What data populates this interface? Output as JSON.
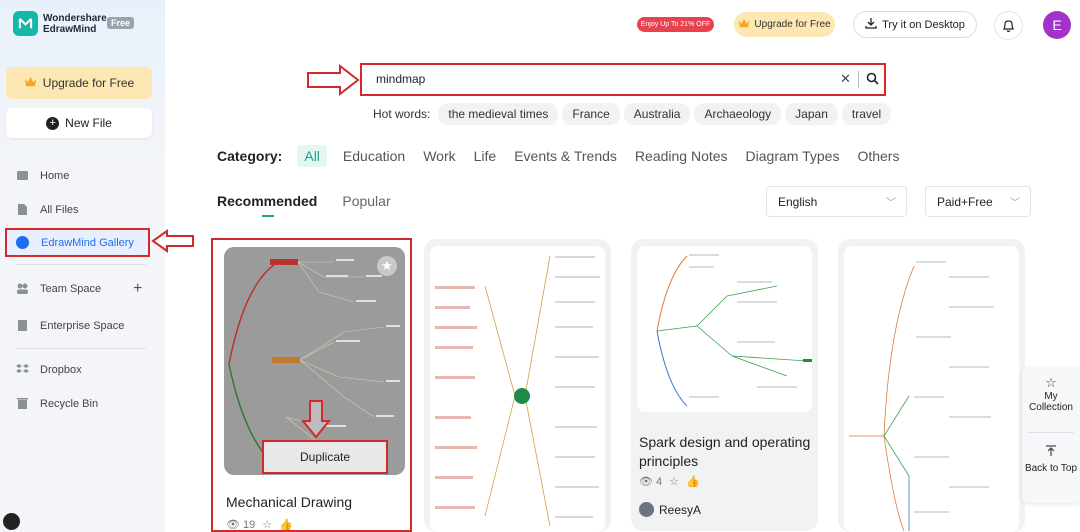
{
  "app": {
    "brand_line1": "Wondershare",
    "brand_line2": "EdrawMind",
    "plan_badge": "Free"
  },
  "sidebar": {
    "upgrade_label": "Upgrade for Free",
    "new_file_label": "New File",
    "items": [
      {
        "label": "Home",
        "icon": "home-icon"
      },
      {
        "label": "All Files",
        "icon": "files-icon"
      },
      {
        "label": "EdrawMind Gallery",
        "icon": "gallery-icon"
      },
      {
        "label": "Team Space",
        "icon": "team-icon"
      },
      {
        "label": "Enterprise Space",
        "icon": "enterprise-icon"
      },
      {
        "label": "Dropbox",
        "icon": "dropbox-icon"
      },
      {
        "label": "Recycle Bin",
        "icon": "trash-icon"
      }
    ]
  },
  "topbar": {
    "promo": "Enjoy Up To 21% OFF",
    "upgrade_label": "Upgrade for Free",
    "desktop_label": "Try it on Desktop",
    "avatar_initial": "E"
  },
  "search": {
    "value": "mindmap",
    "hot_label": "Hot words:",
    "hot_words": [
      "the medieval times",
      "France",
      "Australia",
      "Archaeology",
      "Japan",
      "travel"
    ]
  },
  "category": {
    "label": "Category:",
    "items": [
      "All",
      "Education",
      "Work",
      "Life",
      "Events & Trends",
      "Reading Notes",
      "Diagram Types",
      "Others"
    ]
  },
  "tabs": {
    "recommended": "Recommended",
    "popular": "Popular"
  },
  "filters": {
    "language": "English",
    "price": "Paid+Free"
  },
  "cards": [
    {
      "title": "Mechanical Drawing",
      "views": "19",
      "action": "Duplicate"
    },
    {
      "title": ""
    },
    {
      "title": "Spark design and operating principles",
      "views": "4",
      "author": "ReesyA"
    },
    {
      "title": ""
    }
  ],
  "floating": {
    "collection": "My Collection",
    "back_to_top": "Back to Top"
  },
  "colors": {
    "accent": "#1aa58b",
    "highlight": "#d22a2a",
    "active_nav": "#1e6ef0",
    "avatar": "#a233c8"
  }
}
